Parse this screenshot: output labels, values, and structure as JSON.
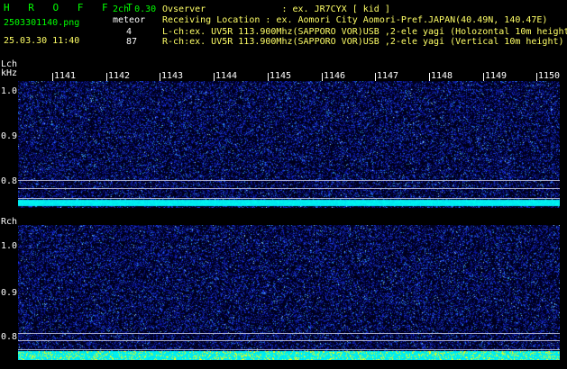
{
  "header": {
    "title": "H R O F F T",
    "filename": "2503301140.png",
    "datetime": "25.03.30 11:40",
    "version": "2ch 0.30",
    "meteor_label": "meteor",
    "lch_count": "4",
    "rch_count": "87",
    "observer_line": "Ovserver              : ex. JR7CYX [ kid ]",
    "location_line": "Receiving Location : ex. Aomori City Aomori-Pref.JAPAN(40.49N, 140.47E)",
    "lch_line": "L-ch:ex. UV5R 113.900Mhz(SAPPORO VOR)USB ,2-ele yagi (Holozontal 10m height)",
    "rch_line": "R-ch:ex. UV5R 113.900Mhz(SAPPORO VOR)USB ,2-ele yagi (Vertical 10m height)"
  },
  "lch": {
    "label": "Lch",
    "unit": "kHz",
    "y_ticks": [
      "1.0",
      "0.9",
      "0.8"
    ]
  },
  "rch": {
    "label": "Rch",
    "y_ticks": [
      "1.0",
      "0.9",
      "0.8"
    ]
  },
  "time_ticks": [
    "1141",
    "1142",
    "1143",
    "1144",
    "1145",
    "1146",
    "1147",
    "1148",
    "1149",
    "1150"
  ],
  "colors": {
    "background": "#000000",
    "noise": "#1a2aa0",
    "signal": "#00e5ff",
    "highlight": "#ffff00",
    "title_green": "#00ff00",
    "text_yellow": "#ffff66"
  }
}
